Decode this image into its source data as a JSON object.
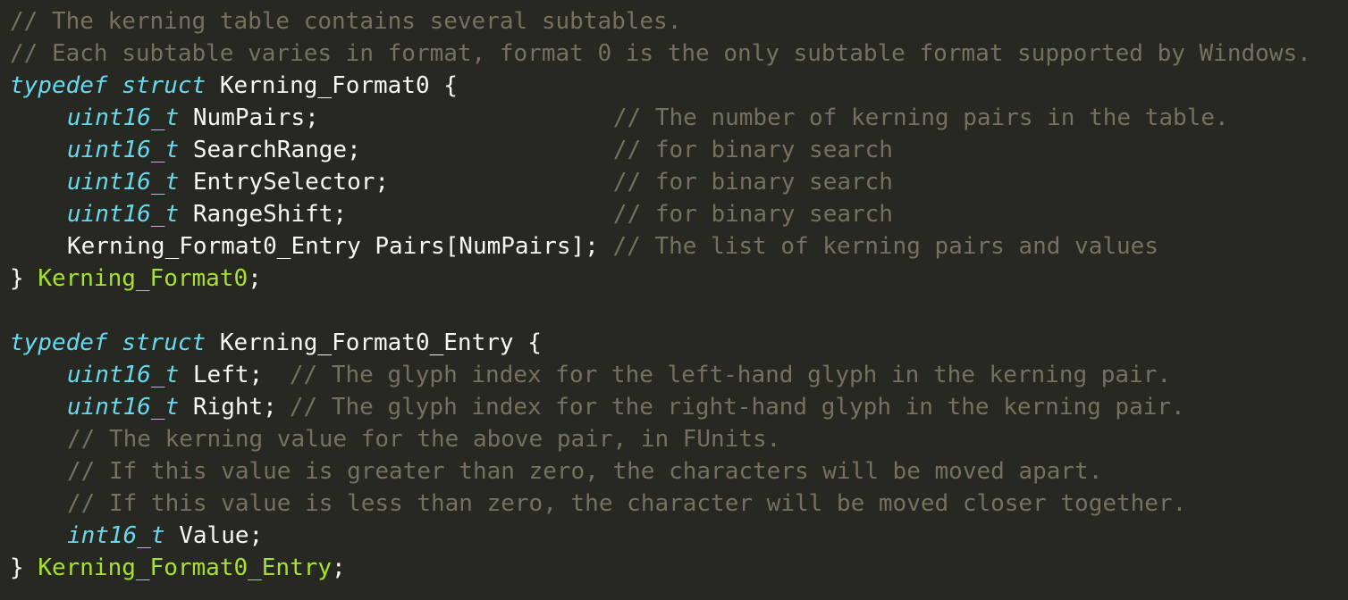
{
  "code": {
    "line1": {
      "comment": "// The kerning table contains several subtables."
    },
    "line2": {
      "comment": "// Each subtable varies in format, format 0 is the only subtable format supported by Windows."
    },
    "line3": {
      "kw1": "typedef",
      "kw2": "struct",
      "name": "Kerning_Format0",
      "brace": "{"
    },
    "line4": {
      "type": "uint16_t",
      "field": "NumPairs;",
      "comment": "// The number of kerning pairs in the table."
    },
    "line5": {
      "type": "uint16_t",
      "field": "SearchRange;",
      "comment": "// for binary search"
    },
    "line6": {
      "type": "uint16_t",
      "field": "EntrySelector;",
      "comment": "// for binary search"
    },
    "line7": {
      "type": "uint16_t",
      "field": "RangeShift;",
      "comment": "// for binary search"
    },
    "line8": {
      "field": "Kerning_Format0_Entry Pairs[NumPairs];",
      "comment": "// The list of kerning pairs and values"
    },
    "line9": {
      "brace": "}",
      "name": "Kerning_Format0",
      "semi": ";"
    },
    "line11": {
      "kw1": "typedef",
      "kw2": "struct",
      "name": "Kerning_Format0_Entry",
      "brace": "{"
    },
    "line12": {
      "type": "uint16_t",
      "field": "Left;",
      "comment": "// The glyph index for the left-hand glyph in the kerning pair."
    },
    "line13": {
      "type": "uint16_t",
      "field": "Right;",
      "comment": "// The glyph index for the right-hand glyph in the kerning pair."
    },
    "line14": {
      "comment": "// The kerning value for the above pair, in FUnits."
    },
    "line15": {
      "comment": "// If this value is greater than zero, the characters will be moved apart."
    },
    "line16": {
      "comment": "// If this value is less than zero, the character will be moved closer together."
    },
    "line17": {
      "type": "int16_t",
      "field": "Value;"
    },
    "line18": {
      "brace": "}",
      "name": "Kerning_Format0_Entry",
      "semi": ";"
    }
  },
  "colors": {
    "background": "#272822",
    "keyword": "#66d9ef",
    "struct_name": "#a6e22e",
    "comment": "#75715e",
    "plain": "#f8f8f2"
  }
}
